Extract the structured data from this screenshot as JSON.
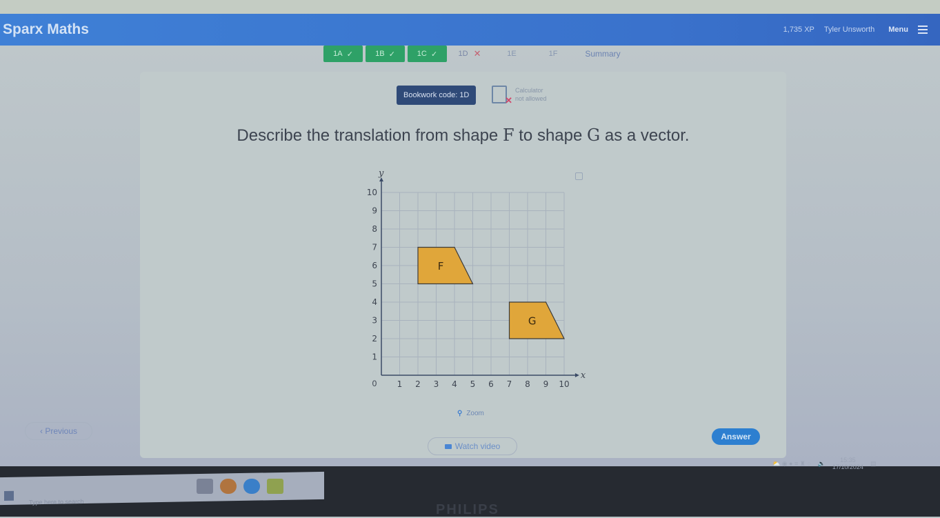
{
  "header": {
    "brand": "Sparx Maths",
    "xp": "1,735 XP",
    "user": "Tyler Unsworth",
    "menu_label": "Menu"
  },
  "tabs": [
    {
      "label": "1A",
      "status": "correct",
      "mark": "✓"
    },
    {
      "label": "1B",
      "status": "correct",
      "mark": "✓"
    },
    {
      "label": "1C",
      "status": "correct",
      "mark": "✓"
    },
    {
      "label": "1D",
      "status": "incorrect",
      "mark": "✕"
    },
    {
      "label": "1E",
      "status": "todo",
      "mark": ""
    },
    {
      "label": "1F",
      "status": "todo",
      "mark": ""
    },
    {
      "label": "Summary",
      "status": "summary",
      "mark": ""
    }
  ],
  "question": {
    "bookwork": "Bookwork code: 1D",
    "calculator_line1": "Calculator",
    "calculator_line2": "not allowed",
    "text_pre": "Describe the translation from shape ",
    "shape1": "F",
    "text_mid": " to shape ",
    "shape2": "G",
    "text_post": " as a vector."
  },
  "graph": {
    "x_label": "x",
    "y_label": "y",
    "x_range": [
      0,
      10
    ],
    "y_range": [
      0,
      10
    ],
    "x_ticks": [
      1,
      2,
      3,
      4,
      5,
      6,
      7,
      8,
      9,
      10
    ],
    "y_ticks": [
      1,
      2,
      3,
      4,
      5,
      6,
      7,
      8,
      9,
      10
    ],
    "origin_label": "0",
    "shapes": [
      {
        "label": "F",
        "vertices": [
          [
            2,
            5
          ],
          [
            2,
            7
          ],
          [
            4,
            7
          ],
          [
            5,
            5
          ]
        ]
      },
      {
        "label": "G",
        "vertices": [
          [
            7,
            2
          ],
          [
            7,
            4
          ],
          [
            9,
            4
          ],
          [
            10,
            2
          ]
        ]
      }
    ],
    "fill": "#e0a63a"
  },
  "controls": {
    "zoom_label": "Zoom",
    "previous_label": "Previous",
    "watch_video_label": "Watch video",
    "answer_label": "Answer"
  },
  "taskbar": {
    "search_placeholder": "Type here to search",
    "time": "15:35",
    "date": "17/10/2024"
  },
  "bezel": {
    "brand": "PHILIPS"
  },
  "colors": {
    "header": "#3a72cc",
    "correct": "#2ea167",
    "answer": "#2d7fd0"
  }
}
